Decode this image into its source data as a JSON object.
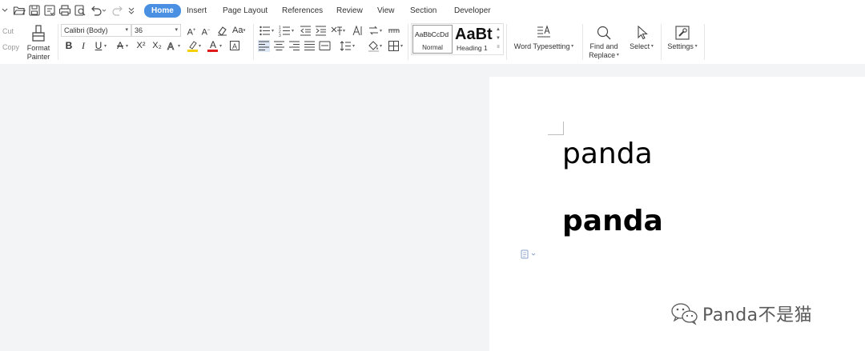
{
  "menu": {
    "tabs": [
      "Home",
      "Insert",
      "Page Layout",
      "References",
      "Review",
      "View",
      "Section",
      "Developer"
    ],
    "active": "Home"
  },
  "quick_access": [
    "open-folder-icon",
    "save-icon",
    "export-pdf-icon",
    "print-icon",
    "print-preview-icon",
    "undo-icon",
    "redo-icon",
    "customize-icon"
  ],
  "clipboard": {
    "cut": "Cut",
    "copy": "Copy",
    "format_painter": "Format Painter"
  },
  "font": {
    "family": "Calibri (Body)",
    "size": "36",
    "bold": "B",
    "italic": "I",
    "underline": "U",
    "superscript": "X²",
    "subscript": "X₂",
    "change_case": "Aa",
    "font_color_letter": "A",
    "highlight_color": "#f5d000",
    "font_color": "#e01a1a"
  },
  "styles": {
    "normal_sample": "AaBbCcDd",
    "normal_label": "Normal",
    "heading_sample": "AaBt",
    "heading_label": "Heading 1"
  },
  "tools": {
    "word_typesetting": "Word Typesetting",
    "find_replace_line1": "Find and",
    "find_replace_line2": "Replace",
    "select": "Select",
    "settings": "Settings"
  },
  "document": {
    "line1": "panda",
    "line2": "panda"
  },
  "watermark": "Panda不是猫",
  "colors": {
    "accent": "#4a90e2",
    "workspace_bg": "#f3f4f6"
  }
}
